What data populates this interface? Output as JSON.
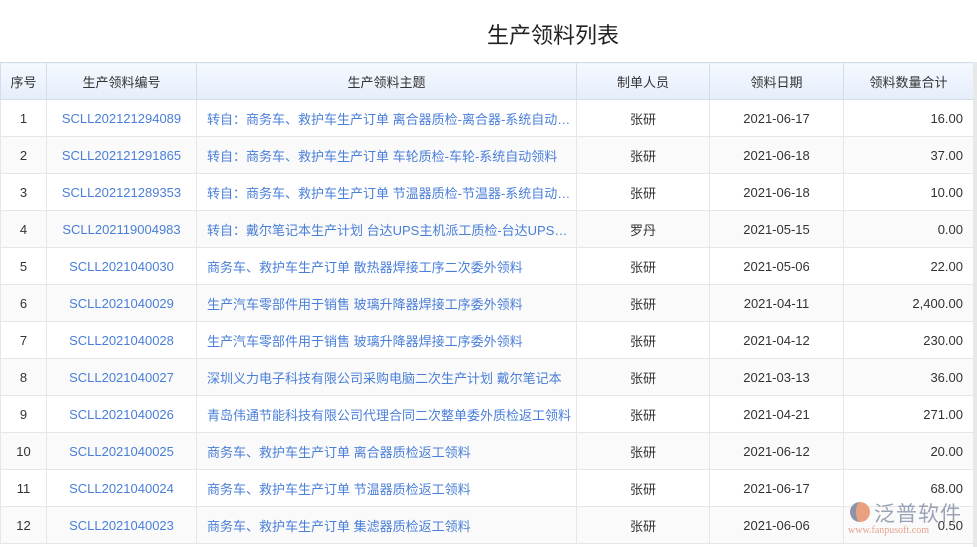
{
  "title": "生产领料列表",
  "columns": [
    "序号",
    "生产领料编号",
    "生产领料主题",
    "制单人员",
    "领料日期",
    "领料数量合计"
  ],
  "rows": [
    [
      "1",
      "SCLL202121294089",
      "转自：商务车、救护车生产订单 离合器质检-离合器-系统自动领料",
      "张研",
      "2021-06-17",
      "16.00"
    ],
    [
      "2",
      "SCLL202121291865",
      "转自：商务车、救护车生产订单 车轮质检-车轮-系统自动领料",
      "张研",
      "2021-06-18",
      "37.00"
    ],
    [
      "3",
      "SCLL202121289353",
      "转自：商务车、救护车生产订单 节温器质检-节温器-系统自动领料",
      "张研",
      "2021-06-18",
      "10.00"
    ],
    [
      "4",
      "SCLL202119004983",
      "转自：戴尔笔记本生产计划 台达UPS主机派工质检-台达UPS主机",
      "罗丹",
      "2021-05-15",
      "0.00"
    ],
    [
      "5",
      "SCLL2021040030",
      "商务车、救护车生产订单 散热器焊接工序二次委外领料",
      "张研",
      "2021-05-06",
      "22.00"
    ],
    [
      "6",
      "SCLL2021040029",
      "生产汽车零部件用于销售 玻璃升降器焊接工序委外领料",
      "张研",
      "2021-04-11",
      "2,400.00"
    ],
    [
      "7",
      "SCLL2021040028",
      "生产汽车零部件用于销售 玻璃升降器焊接工序委外领料",
      "张研",
      "2021-04-12",
      "230.00"
    ],
    [
      "8",
      "SCLL2021040027",
      "深圳义力电子科技有限公司采购电脑二次生产计划 戴尔笔记本",
      "张研",
      "2021-03-13",
      "36.00"
    ],
    [
      "9",
      "SCLL2021040026",
      "青岛伟通节能科技有限公司代理合同二次整单委外质检返工领料",
      "张研",
      "2021-04-21",
      "271.00"
    ],
    [
      "10",
      "SCLL2021040025",
      "商务车、救护车生产订单 离合器质检返工领料",
      "张研",
      "2021-06-12",
      "20.00"
    ],
    [
      "11",
      "SCLL2021040024",
      "商务车、救护车生产订单 节温器质检返工领料",
      "张研",
      "2021-06-17",
      "68.00"
    ],
    [
      "12",
      "SCLL2021040023",
      "商务车、救护车生产订单 集滤器质检返工领料",
      "张研",
      "2021-06-06",
      "0.50"
    ]
  ],
  "watermark": {
    "brand": "泛普软件",
    "url": "www.fanpusoft.com"
  },
  "colors": {
    "link": "#4a7fd8",
    "header_bg": "#e6eefb"
  }
}
